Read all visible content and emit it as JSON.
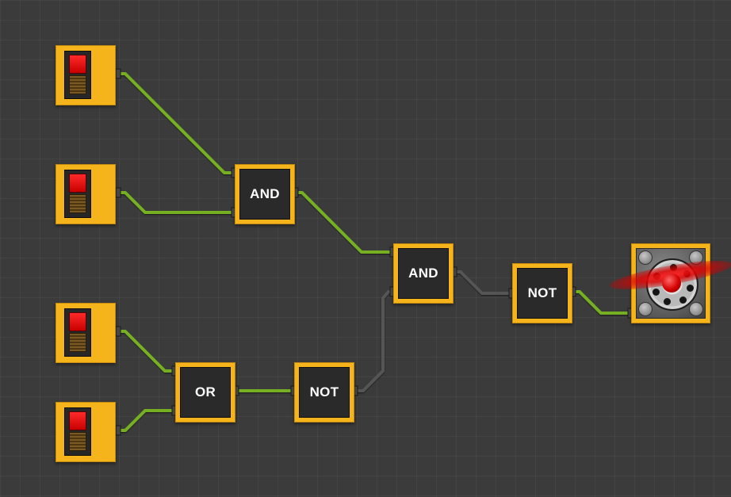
{
  "canvas": {
    "background": "#3b3b3b",
    "grid": true
  },
  "colors": {
    "block_orange": "#f6b41c",
    "block_face": "#2a2a2a",
    "wire_on": "#76b021",
    "wire_off": "#555555",
    "lamp_red": "#e00000"
  },
  "switches": [
    {
      "name": "switch-1",
      "state": "off"
    },
    {
      "name": "switch-2",
      "state": "off"
    },
    {
      "name": "switch-3",
      "state": "off"
    },
    {
      "name": "switch-4",
      "state": "off"
    }
  ],
  "gates": {
    "and_1": {
      "label": "AND"
    },
    "and_2": {
      "label": "AND"
    },
    "or_1": {
      "label": "OR"
    },
    "not_1": {
      "label": "NOT"
    },
    "not_2": {
      "label": "NOT"
    }
  },
  "output": {
    "device": "fan",
    "icon": "fan-icon"
  },
  "wires": [
    {
      "from": "switch-1",
      "to": "and-1",
      "signal": "on"
    },
    {
      "from": "switch-2",
      "to": "and-1",
      "signal": "on"
    },
    {
      "from": "and-1",
      "to": "and-2",
      "signal": "on"
    },
    {
      "from": "switch-3",
      "to": "or-1",
      "signal": "on"
    },
    {
      "from": "switch-4",
      "to": "or-1",
      "signal": "on"
    },
    {
      "from": "or-1",
      "to": "not-1",
      "signal": "on"
    },
    {
      "from": "not-1",
      "to": "and-2",
      "signal": "off"
    },
    {
      "from": "and-2",
      "to": "not-2",
      "signal": "off"
    },
    {
      "from": "not-2",
      "to": "fan",
      "signal": "on"
    }
  ]
}
